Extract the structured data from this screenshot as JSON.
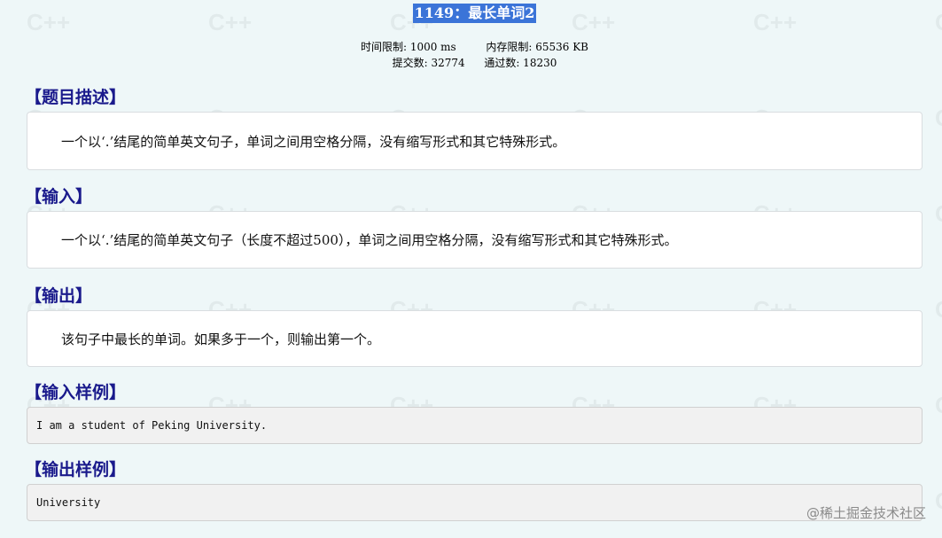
{
  "problem": {
    "title": "1149：最长单词2",
    "time_limit": "时间限制: 1000 ms",
    "memory_limit": "内存限制: 65536 KB",
    "submissions": "提交数: 32774",
    "accepted": "通过数: 18230"
  },
  "sections": {
    "description": {
      "heading": "【题目描述】",
      "text": "一个以‘.’结尾的简单英文句子，单词之间用空格分隔，没有缩写形式和其它特殊形式。"
    },
    "input": {
      "heading": "【输入】",
      "text": "一个以‘.’结尾的简单英文句子（长度不超过500），单词之间用空格分隔，没有缩写形式和其它特殊形式。"
    },
    "output": {
      "heading": "【输出】",
      "text": "该句子中最长的单词。如果多于一个，则输出第一个。"
    },
    "sample_input": {
      "heading": "【输入样例】",
      "code": "I am a student of Peking University."
    },
    "sample_output": {
      "heading": "【输出样例】",
      "code": "University"
    }
  },
  "watermark": "@稀土掘金技术社区",
  "background_mark": "C++",
  "colors": {
    "title_bg": "#3b74d8",
    "heading": "#1a1a8c",
    "page_bg": "#eef7f8"
  }
}
